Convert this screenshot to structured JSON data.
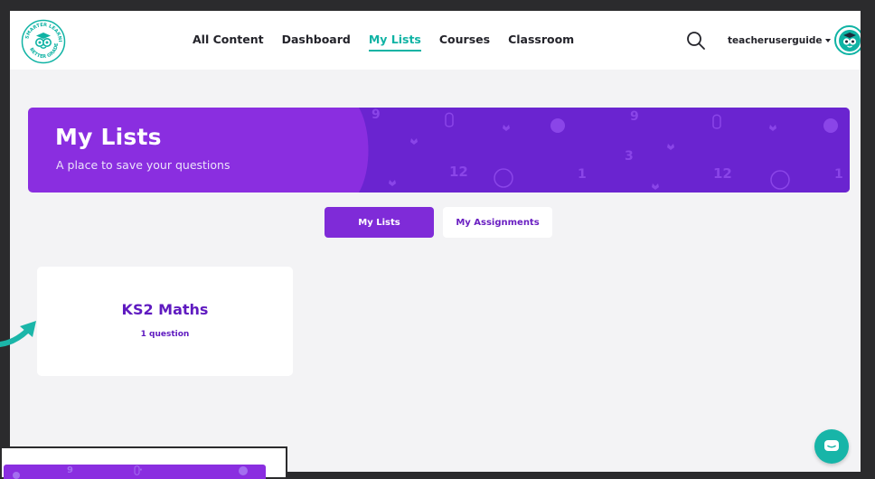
{
  "nav": {
    "logo_text": "SMARTER LEARNING BETTER GRADES",
    "links": [
      {
        "label": "All Content",
        "active": false
      },
      {
        "label": "Dashboard",
        "active": false
      },
      {
        "label": "My Lists",
        "active": true
      },
      {
        "label": "Courses",
        "active": false
      },
      {
        "label": "Classroom",
        "active": false
      }
    ],
    "search_icon": "search-icon",
    "username": "teacheruserguide",
    "avatar_icon": "owl-avatar-icon"
  },
  "hero": {
    "title": "My Lists",
    "subtitle": "A place to save your questions",
    "pattern_glyphs": [
      "9",
      "3",
      "12",
      "1",
      "12",
      "1"
    ]
  },
  "tabs": {
    "my_lists": "My Lists",
    "my_assignments": "My Assignments",
    "active": "my_lists"
  },
  "lists": [
    {
      "title": "KS2 Maths",
      "count": "1 question"
    }
  ],
  "chat": {
    "icon": "chat-icon"
  },
  "colors": {
    "accent_teal": "#0fb3a4",
    "brand_purple": "#8a2ee0",
    "dark_purple": "#5f1ac0",
    "background": "#f3f3f5"
  }
}
